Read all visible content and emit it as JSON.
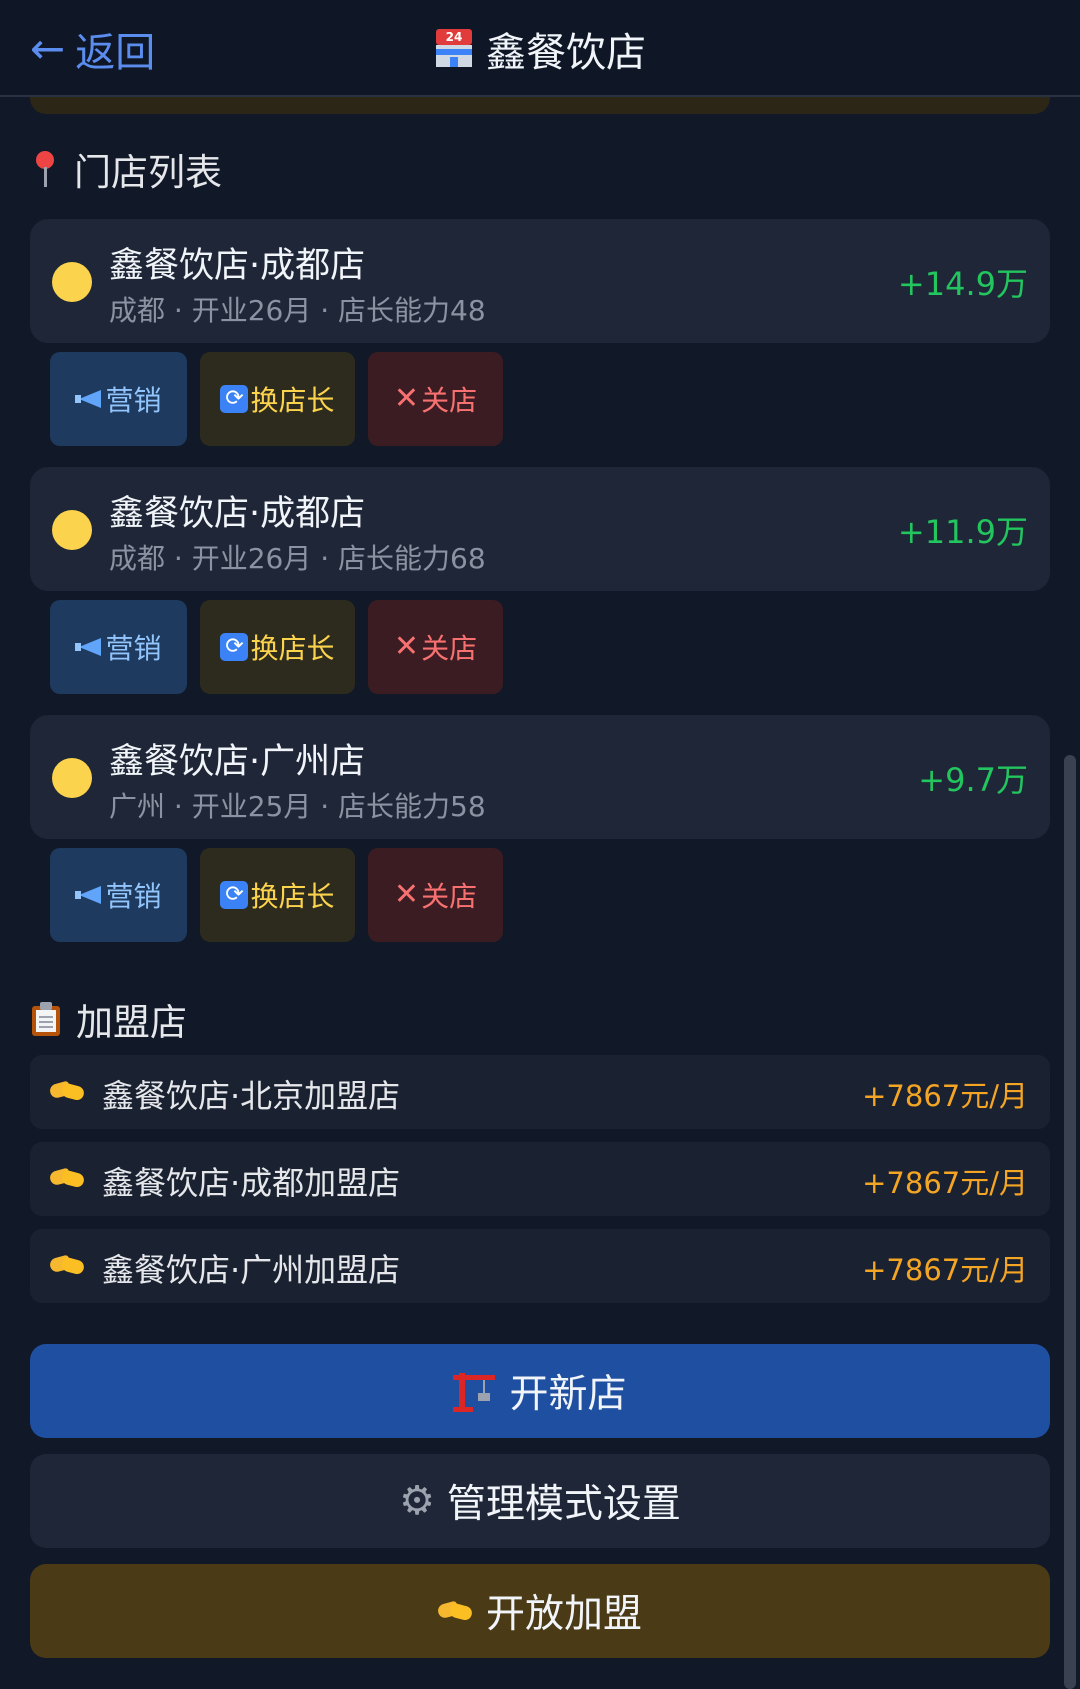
{
  "header": {
    "back_label": "返回",
    "title": "鑫餐饮店",
    "title_icon": "convenience-store-icon"
  },
  "stores_section": {
    "title": "门店列表",
    "icon": "pin-icon"
  },
  "stores": [
    {
      "name": "鑫餐饮店·成都店",
      "meta": "成都 · 开业26月 · 店长能力48",
      "profit": "+14.9万",
      "status_color": "#fcd34d"
    },
    {
      "name": "鑫餐饮店·成都店",
      "meta": "成都 · 开业26月 · 店长能力68",
      "profit": "+11.9万",
      "status_color": "#fcd34d"
    },
    {
      "name": "鑫餐饮店·广州店",
      "meta": "广州 · 开业25月 · 店长能力58",
      "profit": "+9.7万",
      "status_color": "#fcd34d"
    }
  ],
  "store_actions": {
    "marketing": "营销",
    "swap_manager": "换店长",
    "close_store": "关店"
  },
  "franchise_section": {
    "title": "加盟店",
    "icon": "clipboard-icon"
  },
  "franchises": [
    {
      "name": "鑫餐饮店·北京加盟店",
      "income": "+7867元/月"
    },
    {
      "name": "鑫餐饮店·成都加盟店",
      "income": "+7867元/月"
    },
    {
      "name": "鑫餐饮店·广州加盟店",
      "income": "+7867元/月"
    }
  ],
  "buttons": {
    "open_store": "开新店",
    "manage_settings": "管理模式设置",
    "open_franchise": "开放加盟"
  },
  "colors": {
    "background": "#111827",
    "profit_green": "#22c55e",
    "franchise_income": "#f5a524",
    "accent_blue": "#5b8def"
  }
}
